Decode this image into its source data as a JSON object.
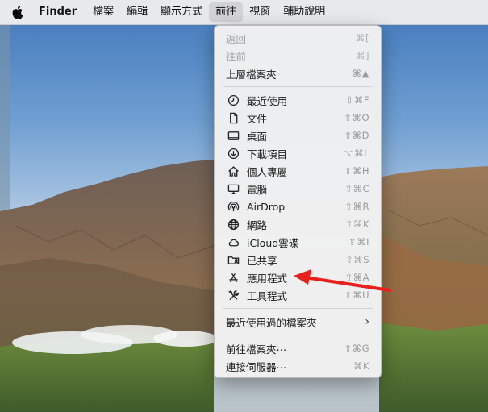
{
  "menubar": {
    "apple_icon": "apple-logo-icon",
    "app_name": "Finder",
    "items": [
      "檔案",
      "編輯",
      "顯示方式",
      "前往",
      "視窗",
      "輔助說明"
    ],
    "open_item": "前往"
  },
  "go_menu": {
    "back": {
      "label": "返回",
      "shortcut": "⌘["
    },
    "forward": {
      "label": "往前",
      "shortcut": "⌘]"
    },
    "enclosing": {
      "label": "上層檔案夾",
      "shortcut": "⌘▲"
    },
    "recents": {
      "label": "最近使用",
      "shortcut": "⇧⌘F",
      "icon": "clock-icon"
    },
    "documents": {
      "label": "文件",
      "shortcut": "⇧⌘O",
      "icon": "document-icon"
    },
    "desktop": {
      "label": "桌面",
      "shortcut": "⇧⌘D",
      "icon": "desktop-icon"
    },
    "downloads": {
      "label": "下載項目",
      "shortcut": "⌥⌘L",
      "icon": "download-icon"
    },
    "home": {
      "label": "個人專屬",
      "shortcut": "⇧⌘H",
      "icon": "home-icon"
    },
    "computer": {
      "label": "電腦",
      "shortcut": "⇧⌘C",
      "icon": "computer-icon"
    },
    "airdrop": {
      "label": "AirDrop",
      "shortcut": "⇧⌘R",
      "icon": "airdrop-icon"
    },
    "network": {
      "label": "網路",
      "shortcut": "⇧⌘K",
      "icon": "globe-icon"
    },
    "icloud": {
      "label": "iCloud雲碟",
      "shortcut": "⇧⌘I",
      "icon": "cloud-icon"
    },
    "shared": {
      "label": "已共享",
      "shortcut": "⇧⌘S",
      "icon": "shared-folder-icon"
    },
    "applications": {
      "label": "應用程式",
      "shortcut": "⇧⌘A",
      "icon": "applications-icon"
    },
    "utilities": {
      "label": "工具程式",
      "shortcut": "⇧⌘U",
      "icon": "tools-icon"
    },
    "recent_folders": {
      "label": "最近使用過的檔案夾"
    },
    "go_to_folder": {
      "label": "前往檔案夾⋯",
      "shortcut": "⇧⌘G"
    },
    "connect_server": {
      "label": "連接伺服器⋯",
      "shortcut": "⌘K"
    }
  },
  "annotation": {
    "color": "#e8201c"
  }
}
